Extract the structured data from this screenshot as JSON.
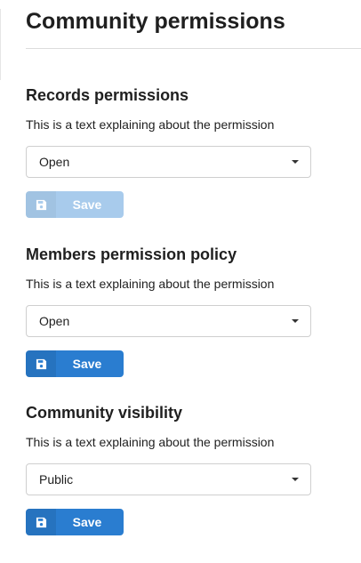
{
  "page": {
    "title": "Community permissions"
  },
  "sections": [
    {
      "title": "Records permissions",
      "description": "This is a text explaining about the permission",
      "select_value": "Open",
      "save_label": "Save",
      "save_enabled": false
    },
    {
      "title": "Members permission policy",
      "description": "This is a text explaining about the permission",
      "select_value": "Open",
      "save_label": "Save",
      "save_enabled": true
    },
    {
      "title": "Community visibility",
      "description": "This is a text explaining about the permission",
      "select_value": "Public",
      "save_label": "Save",
      "save_enabled": true
    }
  ],
  "icons": {
    "save": "floppy-disk-icon",
    "dropdown": "caret-down-icon"
  },
  "colors": {
    "save_active": "#2a7dd0",
    "save_disabled": "#a8cbec"
  }
}
